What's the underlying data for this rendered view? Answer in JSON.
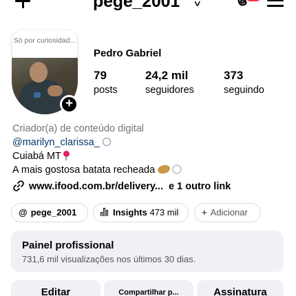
{
  "header": {
    "username": "pege_2001",
    "chevron": "˅",
    "icons": [
      "add-icon",
      "threads-icon",
      "menu-icon"
    ],
    "notification_badge_color": "#ff3040"
  },
  "note": {
    "text": "Só por curiosidad..."
  },
  "profile": {
    "display_name": "Pedro Gabriel",
    "stats": [
      {
        "value": "79",
        "label": "posts"
      },
      {
        "value": "24,2 mil",
        "label": "seguidores"
      },
      {
        "value": "373",
        "label": "seguindo"
      }
    ]
  },
  "bio": {
    "category": "Criador(a) de conteúdo digital",
    "mention": "@marilyn_clarissa_",
    "city": "Cuiabá MT",
    "description": "A mais gostosa batata recheada"
  },
  "link": {
    "url": "www.ifood.com.br/delivery...",
    "more": "e 1 outro link"
  },
  "chips": {
    "threads_label": "pege_2001",
    "insights_label": "Insights",
    "insights_value": "473 mil",
    "add_label": "Adicionar",
    "add_symbol": "+"
  },
  "panel": {
    "title": "Painel profissional",
    "subtitle": "731,6 mil visualizações nos últimos 30 dias."
  },
  "buttons": {
    "edit": "Editar",
    "share": "Compartilhar p...",
    "subscription": "Assinatura"
  },
  "colors": {
    "link_blue": "#00376b",
    "secondary_text": "#737373",
    "panel_bg": "#eff1f5"
  }
}
